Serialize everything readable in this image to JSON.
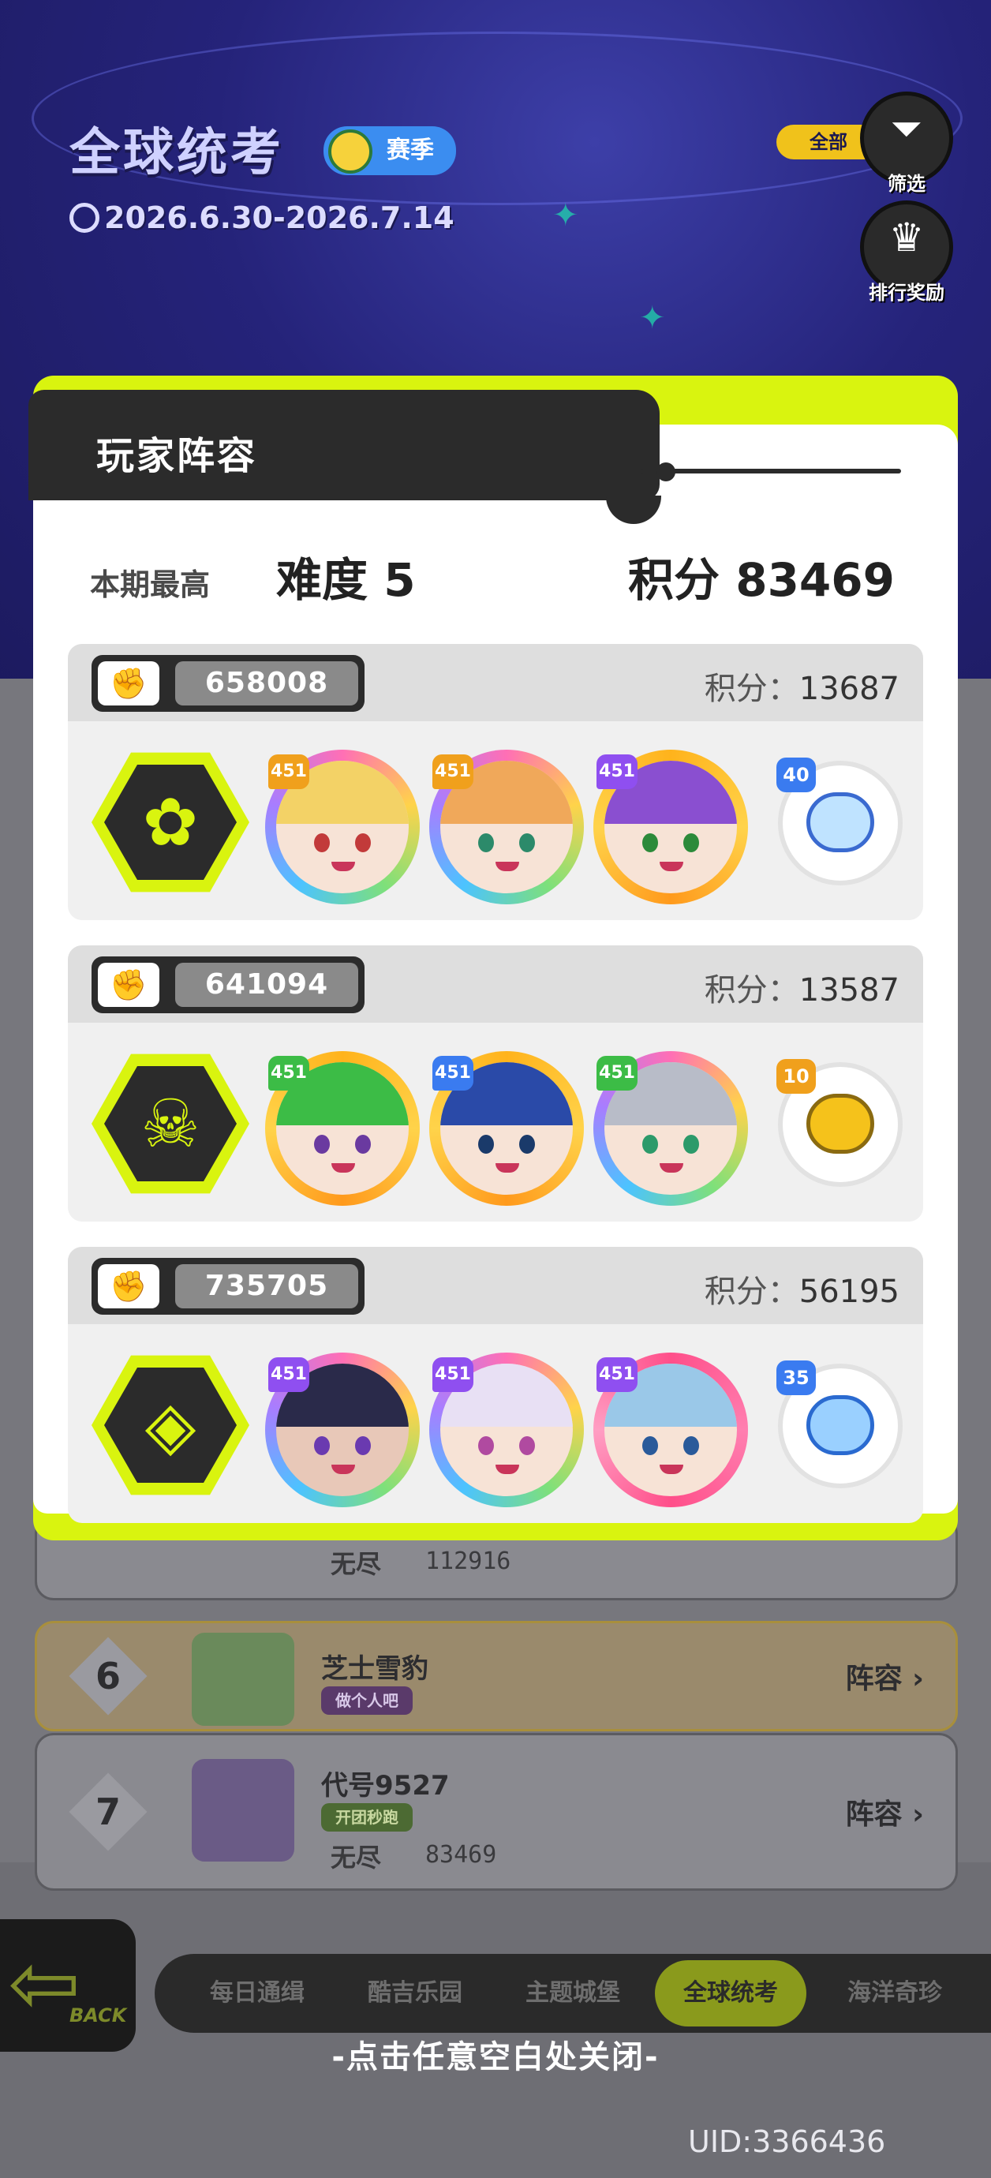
{
  "background": {
    "title": "全球统考",
    "season_label": "赛季",
    "date_range": "2026.6.30-2026.7.14",
    "filter_value": "全部",
    "filter_button": "筛选",
    "rewards_button": "排行奖励",
    "list": [
      {
        "rank": "",
        "mode": "无尽",
        "score": "112916"
      },
      {
        "rank": "6",
        "name": "芝士雪豹",
        "tag": "做个人吧",
        "lineup": "阵容"
      },
      {
        "rank": "7",
        "name": "代号9527",
        "tag": "开团秒跑",
        "mode": "无尽",
        "score": "83469",
        "lineup": "阵容"
      }
    ],
    "back_label": "BACK",
    "tabs": [
      "每日通缉",
      "酷吉乐园",
      "主题城堡",
      "全球统考",
      "海洋奇珍"
    ],
    "active_tab": "全球统考"
  },
  "modal": {
    "title": "玩家阵容",
    "summary": {
      "label": "本期最高",
      "difficulty": "难度 5",
      "score": "积分 83469"
    },
    "teams": [
      {
        "id": "658008",
        "score_label": "积分：",
        "score": "13687",
        "emblem_icon": "flower-icon",
        "heroes": [
          {
            "level": "451",
            "style": "rainbow"
          },
          {
            "level": "451",
            "style": "rainbow"
          },
          {
            "level": "451",
            "style": "gold"
          }
        ],
        "pet": {
          "level": "40"
        }
      },
      {
        "id": "641094",
        "score_label": "积分：",
        "score": "13587",
        "emblem_icon": "skull-icon",
        "heroes": [
          {
            "level": "451",
            "style": "gold"
          },
          {
            "level": "451",
            "style": "gold"
          },
          {
            "level": "451",
            "style": "rainbow"
          }
        ],
        "pet": {
          "level": "10"
        }
      },
      {
        "id": "735705",
        "score_label": "积分：",
        "score": "56195",
        "emblem_icon": "target-icon",
        "heroes": [
          {
            "level": "451",
            "style": "rainbow"
          },
          {
            "level": "451",
            "style": "rainbow"
          },
          {
            "level": "451",
            "style": "pink"
          }
        ],
        "pet": {
          "level": "35"
        }
      }
    ]
  },
  "close_hint": "-点击任意空白处关闭-",
  "uid": "UID:3366436",
  "colors": {
    "accent_lime": "#d9f40f",
    "dark": "#2b2b2b",
    "overlay": "#6e6e74"
  }
}
